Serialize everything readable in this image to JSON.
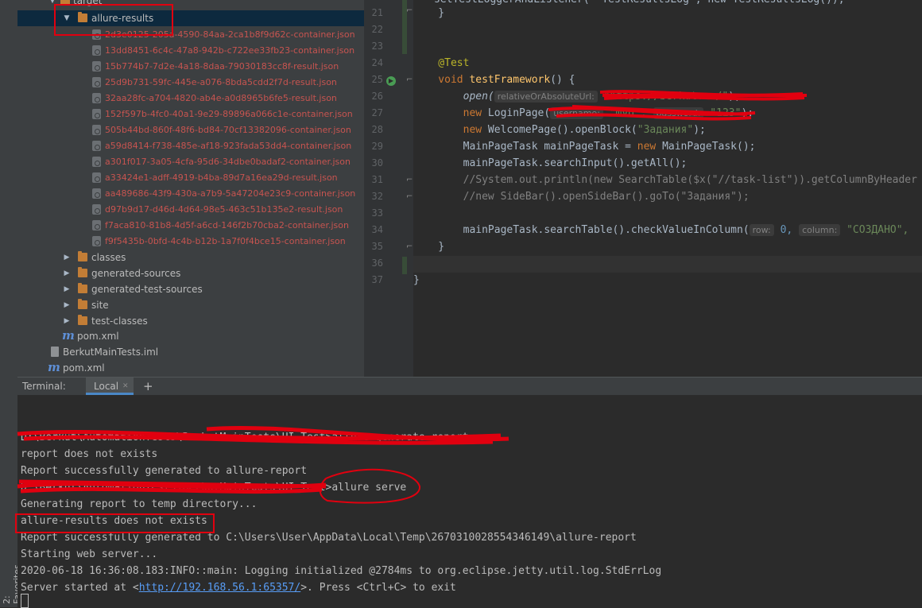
{
  "project_tree": {
    "target_label": "target",
    "allure_results_label": "allure-results",
    "result_files": [
      "2d3e0125-205a-4590-84aa-2ca1b8f9d62c-container.json",
      "13dd8451-6c4c-47a8-942b-c722ee33fb23-container.json",
      "15b774b7-7d2e-4a18-8daa-79030183cc8f-result.json",
      "25d9b731-59fc-445e-a076-8bda5cdd2f7d-result.json",
      "32aa28fc-a704-4820-ab4e-a0d8965b6fe5-result.json",
      "152f597b-4fc0-40a1-9e29-89896a066c1e-container.json",
      "505b44bd-860f-48f6-bd84-70cf13382096-container.json",
      "a59d8414-f738-485e-af18-923fada53dd4-container.json",
      "a301f017-3a05-4cfa-95d6-34dbe0badaf2-container.json",
      "a33424e1-adff-4919-b4ba-89d7a16ea29d-result.json",
      "aa489686-43f9-430a-a7b9-5a47204e23c9-container.json",
      "d97b9d17-d46d-4d64-98e5-463c51b135e2-result.json",
      "f7aca810-81b8-4d5f-a6cd-146f2b70cba2-container.json",
      "f9f5435b-0bfd-4c4b-b12b-1a7f0f4bce15-container.json"
    ],
    "target_folders": [
      "classes",
      "generated-sources",
      "generated-test-sources",
      "site",
      "test-classes"
    ],
    "target_pom": "pom.xml",
    "module_iml": "BerkutMainTests.iml",
    "root_pom": "pom.xml"
  },
  "editor": {
    "line_numbers": [
      "21",
      "22",
      "23",
      "24",
      "25",
      "26",
      "27",
      "28",
      "29",
      "30",
      "31",
      "32",
      "33",
      "34",
      "35",
      "36",
      "37"
    ],
    "line20": "setTestLoggerAndListener( \"TestResultsLog\", new TestResultsLog());",
    "line21": "    }",
    "line24": "    @Test",
    "line25_kw": "    void ",
    "line25_fn": "testFramework",
    "line25_rest": "() {",
    "line26_fn": "        open(",
    "line26_hint": "relativeOrAbsoluteUrl:",
    "line26_str": " \"https://berkut.ru/\"",
    "line26_end": ");",
    "line27_kw": "        new ",
    "line27_rest": "LoginPage(",
    "line27_hint1": "username:",
    "line27_str1": " \"mvd\",",
    "line27_hint2": "password:",
    "line27_str2": " \"123\"",
    "line27_end": ");",
    "line28_kw": "        new ",
    "line28_rest": "WelcomePage().openBlock(",
    "line28_str": "\"Задания\"",
    "line28_end": ");",
    "line29_a": "        MainPageTask mainPageTask = ",
    "line29_kw": "new ",
    "line29_b": "MainPageTask();",
    "line30": "        mainPageTask.searchInput().getAll();",
    "line31": "        //System.out.println(new SearchTable($x(\"//task-list\")).getColumnByHeader",
    "line32": "        //new SideBar().openSideBar().goTo(\"Задания\");",
    "line34_a": "        mainPageTask.searchTable().checkValueInColumn(",
    "line34_hint1": "row:",
    "line34_num": " 0,",
    "line34_hint2": "column:",
    "line34_str": " \"СОЗДАНО\",",
    "line35": "    }",
    "line37": "}"
  },
  "terminal": {
    "title": "Terminal:",
    "tab_label": "Local",
    "tab_close": "✕",
    "add_label": "+",
    "lines": {
      "l0": "D:\\Berkut\\AutomationTests\\BerkutMainTests\\UI_Test>allure generate report",
      "l1": "report does not exists",
      "l2": "Report successfully generated to allure-report",
      "l3": "D:\\Berkut\\AutomationTests\\BerkutMainTests\\UI_Test>allure serve",
      "l4": "Generating report to temp directory...",
      "l5": "allure-results does not exists",
      "l6": "Report successfully generated to C:\\Users\\User\\AppData\\Local\\Temp\\2670310028554346149\\allure-report",
      "l7": "Starting web server...",
      "l8": "2020-06-18 16:36:08.183:INFO::main: Logging initialized @2784ms to org.eclipse.jetty.util.log.StdErrLog",
      "l9_a": "Server started at <",
      "l9_link": "http://192.168.56.1:65357/",
      "l9_b": ">. Press <Ctrl+C> to exit"
    }
  },
  "side_strip": {
    "favorites": "2: Favorites"
  },
  "colors": {
    "annotation_red": "#e1000f",
    "editor_bg": "#2b2b2b",
    "panel_bg": "#3c3f41",
    "selection": "#0d293e"
  }
}
